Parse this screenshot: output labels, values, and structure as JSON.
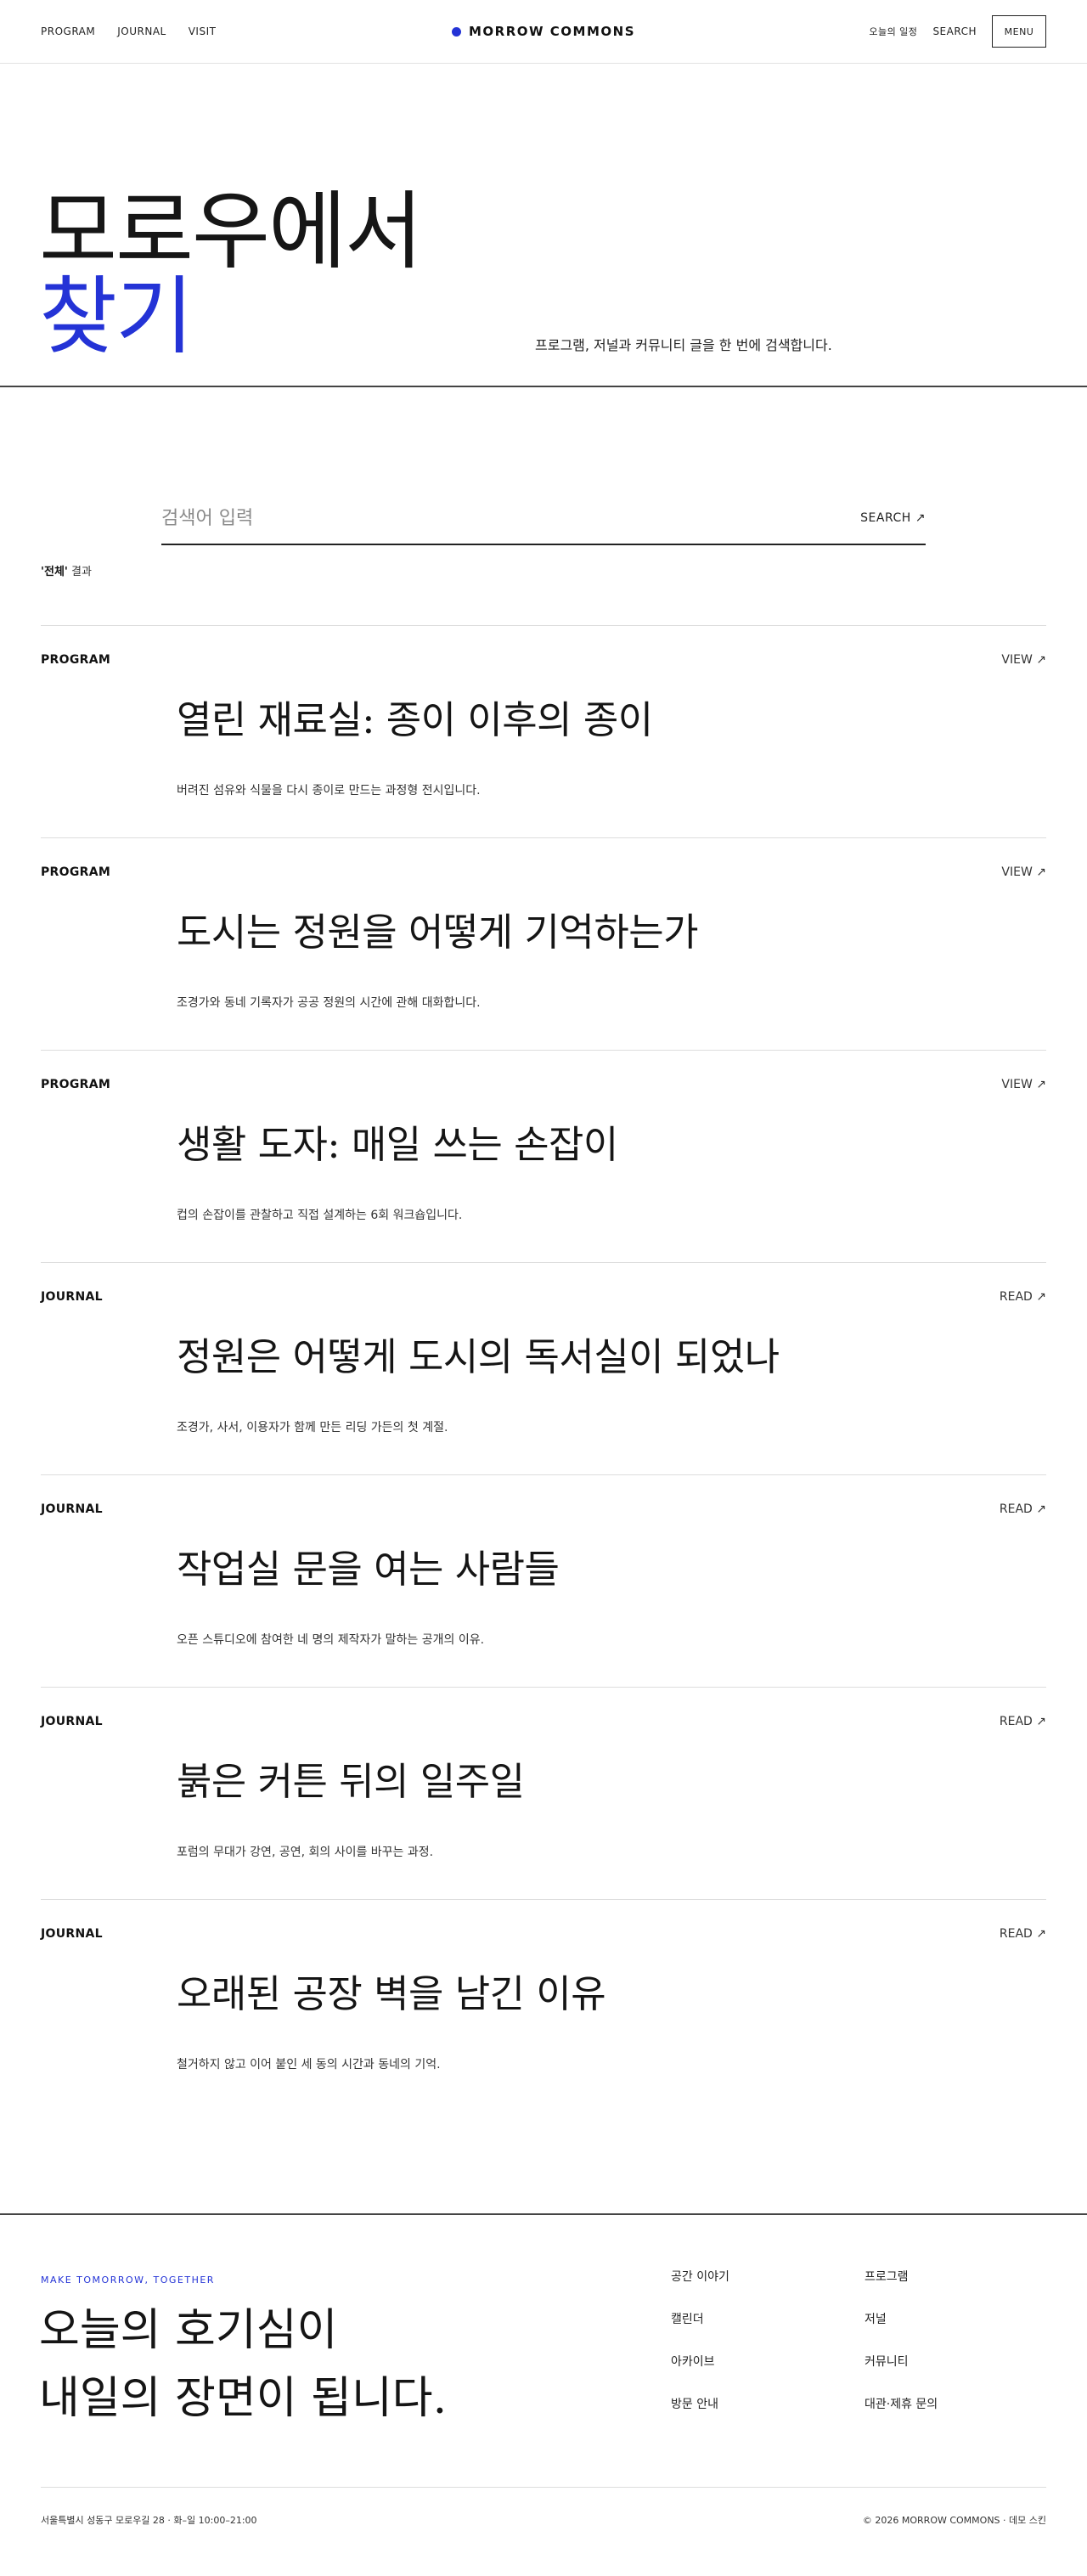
{
  "header": {
    "nav_left": [
      "PROGRAM",
      "JOURNAL",
      "VISIT"
    ],
    "brand": "MORROW COMMONS",
    "schedule": "오늘의 일정",
    "search": "SEARCH",
    "menu": "MENU"
  },
  "hero": {
    "title_line1": "모로우에서",
    "title_line2": "찾기",
    "subtitle": "프로그램, 저널과 커뮤니티 글을 한 번에 검색합니다."
  },
  "search": {
    "placeholder": "검색어 입력",
    "button": "SEARCH ↗",
    "scope_value": "'전체'",
    "scope_suffix": " 결과"
  },
  "results": [
    {
      "category": "PROGRAM",
      "action": "VIEW ↗",
      "title": "열린 재료실: 종이 이후의 종이",
      "description": "버려진 섬유와 식물을 다시 종이로 만드는 과정형 전시입니다."
    },
    {
      "category": "PROGRAM",
      "action": "VIEW ↗",
      "title": "도시는 정원을 어떻게 기억하는가",
      "description": "조경가와 동네 기록자가 공공 정원의 시간에 관해 대화합니다."
    },
    {
      "category": "PROGRAM",
      "action": "VIEW ↗",
      "title": "생활 도자: 매일 쓰는 손잡이",
      "description": "컵의 손잡이를 관찰하고 직접 설계하는 6회 워크숍입니다."
    },
    {
      "category": "JOURNAL",
      "action": "READ ↗",
      "title": "정원은 어떻게 도시의 독서실이 되었나",
      "description": "조경가, 사서, 이용자가 함께 만든 리딩 가든의 첫 계절."
    },
    {
      "category": "JOURNAL",
      "action": "READ ↗",
      "title": "작업실 문을 여는 사람들",
      "description": "오픈 스튜디오에 참여한 네 명의 제작자가 말하는 공개의 이유."
    },
    {
      "category": "JOURNAL",
      "action": "READ ↗",
      "title": "붉은 커튼 뒤의 일주일",
      "description": "포럼의 무대가 강연, 공연, 회의 사이를 바꾸는 과정."
    },
    {
      "category": "JOURNAL",
      "action": "READ ↗",
      "title": "오래된 공장 벽을 남긴 이유",
      "description": "철거하지 않고 이어 붙인 세 동의 시간과 동네의 기억."
    }
  ],
  "footer": {
    "kicker": "MAKE TOMORROW, TOGETHER",
    "tagline_line1": "오늘의 호기심이",
    "tagline_line2": "내일의 장면이 됩니다.",
    "links": [
      "공간 이야기",
      "프로그램",
      "캘린더",
      "저널",
      "아카이브",
      "커뮤니티",
      "방문 안내",
      "대관·제휴 문의"
    ],
    "address": "서울특별시 성동구 모로우길 28 · 화–일 10:00–21:00",
    "copyright": "© 2026 MORROW COMMONS · 데모 스킨"
  },
  "colors": {
    "accent": "#2433d6",
    "text": "#111111",
    "rule": "#dddddd"
  }
}
